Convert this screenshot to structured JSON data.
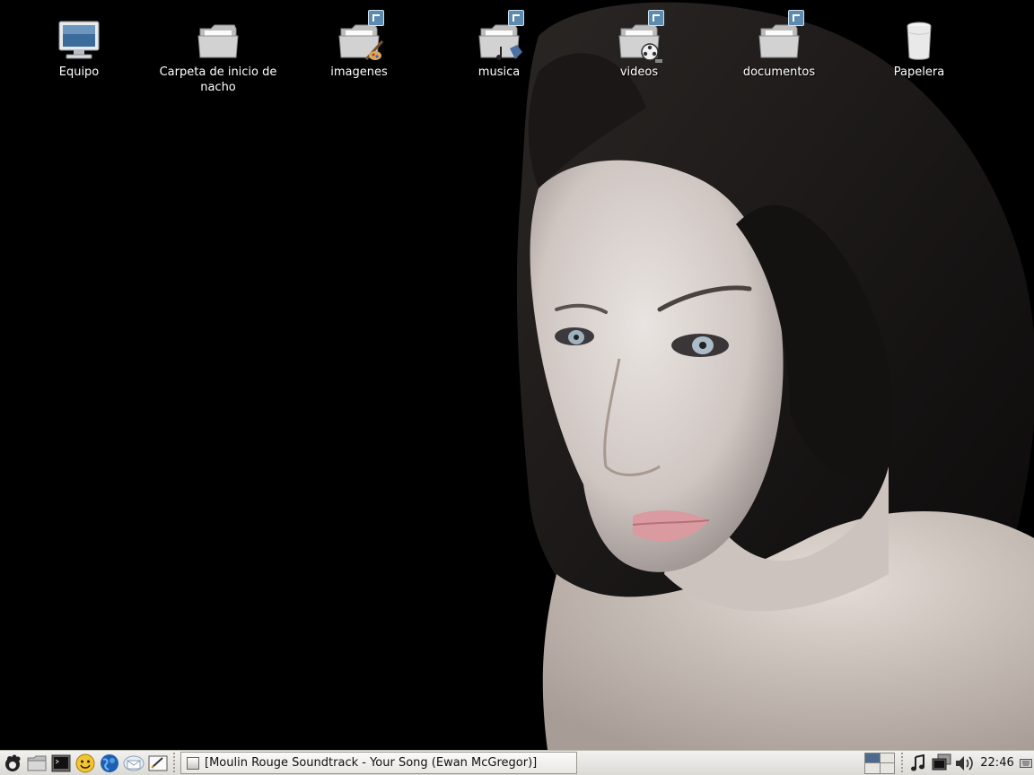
{
  "desktop": {
    "icons": [
      {
        "label": "Equipo",
        "icon": "computer-icon",
        "shortcut": false
      },
      {
        "label": "Carpeta de inicio de nacho",
        "icon": "home-folder-icon",
        "shortcut": false
      },
      {
        "label": "imagenes",
        "icon": "pictures-folder-icon",
        "shortcut": true
      },
      {
        "label": "musica",
        "icon": "music-folder-icon",
        "shortcut": true
      },
      {
        "label": "videos",
        "icon": "videos-folder-icon",
        "shortcut": true
      },
      {
        "label": "documentos",
        "icon": "documents-folder-icon",
        "shortcut": true
      },
      {
        "label": "Papelera",
        "icon": "trash-icon",
        "shortcut": false
      }
    ]
  },
  "panel": {
    "launchers": [
      "main-menu-icon",
      "file-manager-icon",
      "terminal-icon",
      "messenger-icon",
      "web-browser-icon",
      "mail-client-icon",
      "text-editor-icon"
    ],
    "task": {
      "title": "[Moulin Rouge Soundtrack - Your Song (Ewan McGregor)]"
    },
    "tray": [
      "workspace-switcher",
      "music-player-icon",
      "network-icon",
      "volume-icon",
      "keyboard-icon"
    ],
    "clock": "22:46"
  },
  "colors": {
    "panel": "#dcdad5",
    "desktop": "#000000",
    "badge": "#5d8bb0"
  }
}
